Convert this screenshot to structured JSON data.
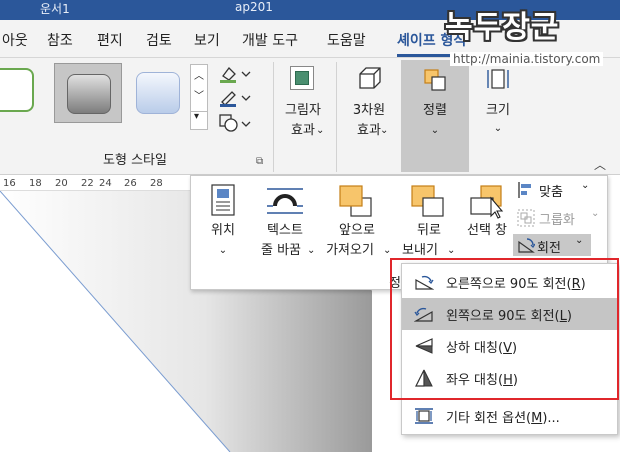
{
  "titlebar": {
    "left_fragment": "운서1",
    "middle_fragment": "ap201"
  },
  "tabs": [
    {
      "label": "아웃",
      "active": false
    },
    {
      "label": "참조",
      "active": false
    },
    {
      "label": "편지",
      "active": false
    },
    {
      "label": "검토",
      "active": false
    },
    {
      "label": "보기",
      "active": false
    },
    {
      "label": "개발 도구",
      "active": false
    },
    {
      "label": "도움말",
      "active": false
    },
    {
      "label": "셰이프 형식",
      "active": true
    }
  ],
  "ribbon": {
    "shape_styles_group": "도형 스타일",
    "picture_effects": {
      "line1": "그림자",
      "line2": "효과"
    },
    "effects_3d": {
      "line1": "3차원",
      "line2": "효과"
    },
    "arrange": {
      "label": "정렬"
    },
    "size": {
      "label": "크기"
    }
  },
  "ruler": {
    "numbers": [
      "16",
      "18",
      "20",
      "22",
      "24",
      "26",
      "28"
    ]
  },
  "arrange_popup": {
    "position": {
      "line1": "위치"
    },
    "wrap_text": {
      "line1": "텍스트",
      "line2": "줄 바꿈"
    },
    "bring_forward": {
      "line1": "앞으로",
      "line2": "가져오기"
    },
    "send_backward": {
      "line1": "뒤로",
      "line2": "보내기"
    },
    "selection_pane": {
      "line1": "선택 창"
    },
    "align": "맞춤",
    "group": "그룹화",
    "rotate": "회전",
    "truncated": "정"
  },
  "rotate_menu": {
    "items": [
      {
        "label": "오른쪽으로 90도 회전",
        "key": "R",
        "highlighted": false
      },
      {
        "label": "왼쪽으로 90도 회전",
        "key": "L",
        "highlighted": true
      },
      {
        "label": "상하 대칭",
        "key": "V",
        "highlighted": false
      },
      {
        "label": "좌우 대칭",
        "key": "H",
        "highlighted": false
      },
      {
        "label": "기타 회전 옵션",
        "key": "M",
        "suffix": "...",
        "highlighted": false
      }
    ]
  },
  "watermark": {
    "title": "녹두장군",
    "url": "http://mainia.tistory.com"
  },
  "colors": {
    "accent": "#2b579a",
    "highlight_box": "#e0262b",
    "shape_fill": "#f7c56b"
  }
}
